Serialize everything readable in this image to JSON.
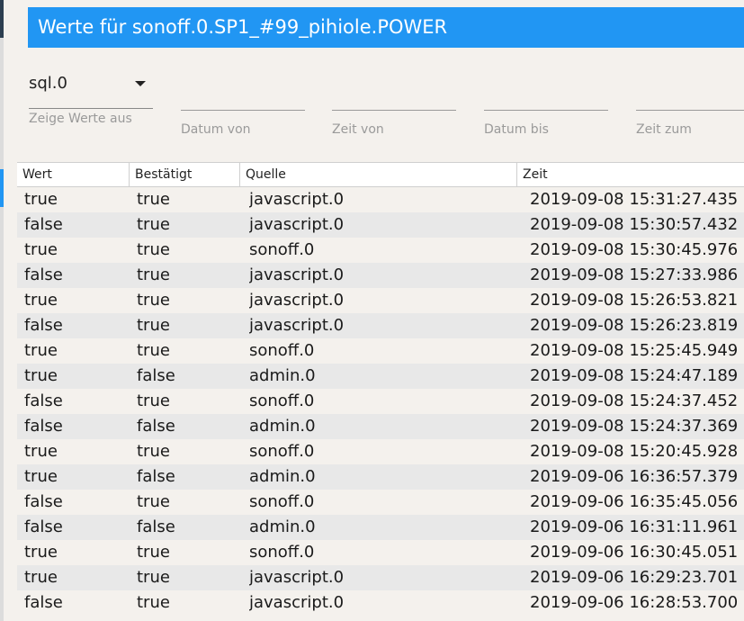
{
  "window": {
    "title": "Werte für sonoff.0.SP1_#99_pihiole.POWER"
  },
  "filters": {
    "instance": {
      "value": "sql.0",
      "label": "Zeige Werte aus"
    },
    "date_from_label": "Datum von",
    "time_from_label": "Zeit von",
    "date_to_label": "Datum bis",
    "time_to_label": "Zeit zum"
  },
  "table": {
    "columns": [
      "Wert",
      "Bestätigt",
      "Quelle",
      "Zeit"
    ],
    "rows": [
      {
        "wert": "true",
        "bestaetigt": "true",
        "quelle": "javascript.0",
        "zeit": "2019-09-08 15:31:27.435"
      },
      {
        "wert": "false",
        "bestaetigt": "true",
        "quelle": "javascript.0",
        "zeit": "2019-09-08 15:30:57.432"
      },
      {
        "wert": "true",
        "bestaetigt": "true",
        "quelle": "sonoff.0",
        "zeit": "2019-09-08 15:30:45.976"
      },
      {
        "wert": "false",
        "bestaetigt": "true",
        "quelle": "javascript.0",
        "zeit": "2019-09-08 15:27:33.986"
      },
      {
        "wert": "true",
        "bestaetigt": "true",
        "quelle": "javascript.0",
        "zeit": "2019-09-08 15:26:53.821"
      },
      {
        "wert": "false",
        "bestaetigt": "true",
        "quelle": "javascript.0",
        "zeit": "2019-09-08 15:26:23.819"
      },
      {
        "wert": "true",
        "bestaetigt": "true",
        "quelle": "sonoff.0",
        "zeit": "2019-09-08 15:25:45.949"
      },
      {
        "wert": "true",
        "bestaetigt": "false",
        "quelle": "admin.0",
        "zeit": "2019-09-08 15:24:47.189"
      },
      {
        "wert": "false",
        "bestaetigt": "true",
        "quelle": "sonoff.0",
        "zeit": "2019-09-08 15:24:37.452"
      },
      {
        "wert": "false",
        "bestaetigt": "false",
        "quelle": "admin.0",
        "zeit": "2019-09-08 15:24:37.369"
      },
      {
        "wert": "true",
        "bestaetigt": "true",
        "quelle": "sonoff.0",
        "zeit": "2019-09-08 15:20:45.928"
      },
      {
        "wert": "true",
        "bestaetigt": "false",
        "quelle": "admin.0",
        "zeit": "2019-09-06 16:36:57.379"
      },
      {
        "wert": "false",
        "bestaetigt": "true",
        "quelle": "sonoff.0",
        "zeit": "2019-09-06 16:35:45.056"
      },
      {
        "wert": "false",
        "bestaetigt": "false",
        "quelle": "admin.0",
        "zeit": "2019-09-06 16:31:11.961"
      },
      {
        "wert": "true",
        "bestaetigt": "true",
        "quelle": "sonoff.0",
        "zeit": "2019-09-06 16:30:45.051"
      },
      {
        "wert": "true",
        "bestaetigt": "true",
        "quelle": "javascript.0",
        "zeit": "2019-09-06 16:29:23.701"
      },
      {
        "wert": "false",
        "bestaetigt": "true",
        "quelle": "javascript.0",
        "zeit": "2019-09-06 16:28:53.700"
      }
    ]
  },
  "icons": {
    "dropdown": "chevron-down-icon"
  },
  "colors": {
    "titlebar": "#2196f3",
    "background": "#f4f1ed",
    "row_alt": "#e8e8e8"
  }
}
